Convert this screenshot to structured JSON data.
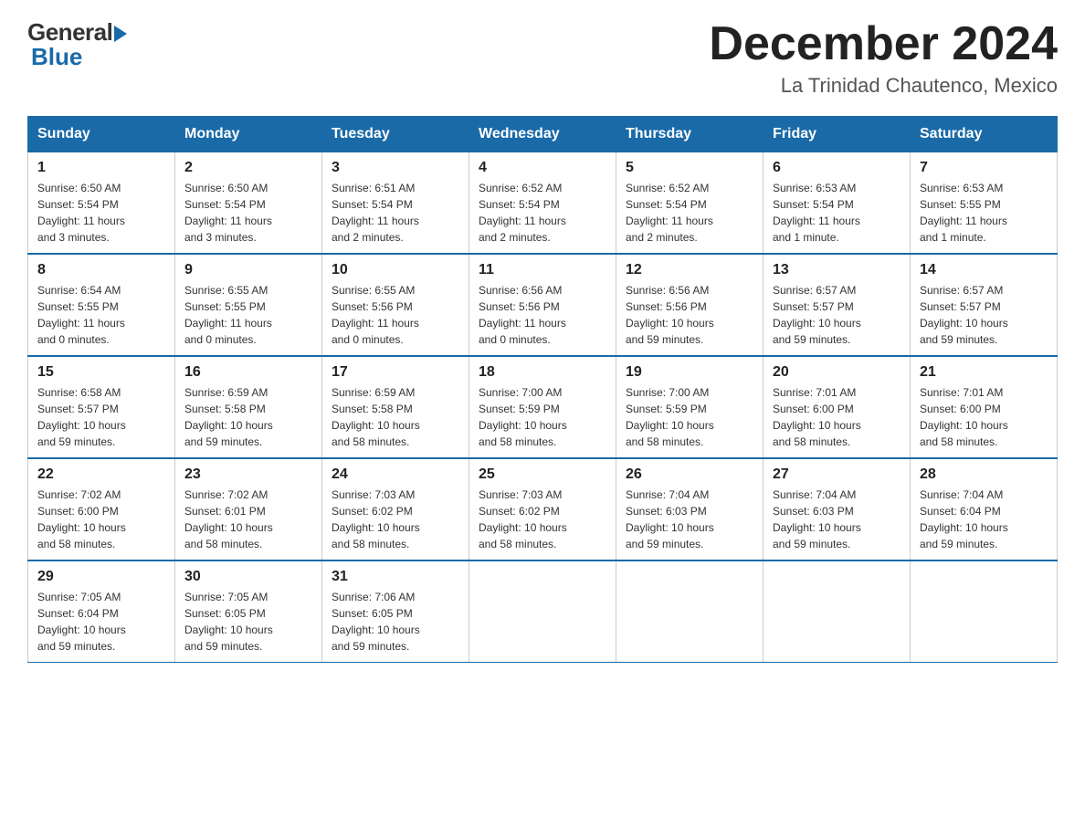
{
  "logo": {
    "text_general": "General",
    "text_blue": "Blue"
  },
  "header": {
    "month_title": "December 2024",
    "location": "La Trinidad Chautenco, Mexico"
  },
  "days_of_week": [
    "Sunday",
    "Monday",
    "Tuesday",
    "Wednesday",
    "Thursday",
    "Friday",
    "Saturday"
  ],
  "weeks": [
    [
      {
        "day": "1",
        "sunrise": "6:50 AM",
        "sunset": "5:54 PM",
        "daylight": "11 hours and 3 minutes."
      },
      {
        "day": "2",
        "sunrise": "6:50 AM",
        "sunset": "5:54 PM",
        "daylight": "11 hours and 3 minutes."
      },
      {
        "day": "3",
        "sunrise": "6:51 AM",
        "sunset": "5:54 PM",
        "daylight": "11 hours and 2 minutes."
      },
      {
        "day": "4",
        "sunrise": "6:52 AM",
        "sunset": "5:54 PM",
        "daylight": "11 hours and 2 minutes."
      },
      {
        "day": "5",
        "sunrise": "6:52 AM",
        "sunset": "5:54 PM",
        "daylight": "11 hours and 2 minutes."
      },
      {
        "day": "6",
        "sunrise": "6:53 AM",
        "sunset": "5:54 PM",
        "daylight": "11 hours and 1 minute."
      },
      {
        "day": "7",
        "sunrise": "6:53 AM",
        "sunset": "5:55 PM",
        "daylight": "11 hours and 1 minute."
      }
    ],
    [
      {
        "day": "8",
        "sunrise": "6:54 AM",
        "sunset": "5:55 PM",
        "daylight": "11 hours and 0 minutes."
      },
      {
        "day": "9",
        "sunrise": "6:55 AM",
        "sunset": "5:55 PM",
        "daylight": "11 hours and 0 minutes."
      },
      {
        "day": "10",
        "sunrise": "6:55 AM",
        "sunset": "5:56 PM",
        "daylight": "11 hours and 0 minutes."
      },
      {
        "day": "11",
        "sunrise": "6:56 AM",
        "sunset": "5:56 PM",
        "daylight": "11 hours and 0 minutes."
      },
      {
        "day": "12",
        "sunrise": "6:56 AM",
        "sunset": "5:56 PM",
        "daylight": "10 hours and 59 minutes."
      },
      {
        "day": "13",
        "sunrise": "6:57 AM",
        "sunset": "5:57 PM",
        "daylight": "10 hours and 59 minutes."
      },
      {
        "day": "14",
        "sunrise": "6:57 AM",
        "sunset": "5:57 PM",
        "daylight": "10 hours and 59 minutes."
      }
    ],
    [
      {
        "day": "15",
        "sunrise": "6:58 AM",
        "sunset": "5:57 PM",
        "daylight": "10 hours and 59 minutes."
      },
      {
        "day": "16",
        "sunrise": "6:59 AM",
        "sunset": "5:58 PM",
        "daylight": "10 hours and 59 minutes."
      },
      {
        "day": "17",
        "sunrise": "6:59 AM",
        "sunset": "5:58 PM",
        "daylight": "10 hours and 58 minutes."
      },
      {
        "day": "18",
        "sunrise": "7:00 AM",
        "sunset": "5:59 PM",
        "daylight": "10 hours and 58 minutes."
      },
      {
        "day": "19",
        "sunrise": "7:00 AM",
        "sunset": "5:59 PM",
        "daylight": "10 hours and 58 minutes."
      },
      {
        "day": "20",
        "sunrise": "7:01 AM",
        "sunset": "6:00 PM",
        "daylight": "10 hours and 58 minutes."
      },
      {
        "day": "21",
        "sunrise": "7:01 AM",
        "sunset": "6:00 PM",
        "daylight": "10 hours and 58 minutes."
      }
    ],
    [
      {
        "day": "22",
        "sunrise": "7:02 AM",
        "sunset": "6:00 PM",
        "daylight": "10 hours and 58 minutes."
      },
      {
        "day": "23",
        "sunrise": "7:02 AM",
        "sunset": "6:01 PM",
        "daylight": "10 hours and 58 minutes."
      },
      {
        "day": "24",
        "sunrise": "7:03 AM",
        "sunset": "6:02 PM",
        "daylight": "10 hours and 58 minutes."
      },
      {
        "day": "25",
        "sunrise": "7:03 AM",
        "sunset": "6:02 PM",
        "daylight": "10 hours and 58 minutes."
      },
      {
        "day": "26",
        "sunrise": "7:04 AM",
        "sunset": "6:03 PM",
        "daylight": "10 hours and 59 minutes."
      },
      {
        "day": "27",
        "sunrise": "7:04 AM",
        "sunset": "6:03 PM",
        "daylight": "10 hours and 59 minutes."
      },
      {
        "day": "28",
        "sunrise": "7:04 AM",
        "sunset": "6:04 PM",
        "daylight": "10 hours and 59 minutes."
      }
    ],
    [
      {
        "day": "29",
        "sunrise": "7:05 AM",
        "sunset": "6:04 PM",
        "daylight": "10 hours and 59 minutes."
      },
      {
        "day": "30",
        "sunrise": "7:05 AM",
        "sunset": "6:05 PM",
        "daylight": "10 hours and 59 minutes."
      },
      {
        "day": "31",
        "sunrise": "7:06 AM",
        "sunset": "6:05 PM",
        "daylight": "10 hours and 59 minutes."
      },
      null,
      null,
      null,
      null
    ]
  ],
  "labels": {
    "sunrise": "Sunrise:",
    "sunset": "Sunset:",
    "daylight": "Daylight:"
  }
}
